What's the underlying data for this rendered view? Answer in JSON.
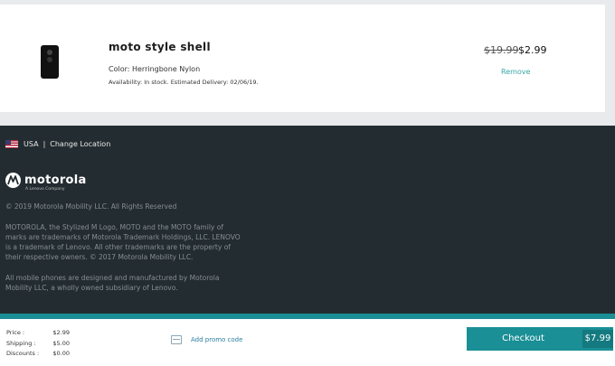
{
  "cart": {
    "item": {
      "name": "moto style shell",
      "color": "Color: Herringbone Nylon",
      "availability": "Availability: In stock. Estimated Delivery: 02/06/19.",
      "price_original": "$19.99",
      "price_current": "$2.99",
      "remove_label": "Remove",
      "image_icon": "phone-shell-icon"
    }
  },
  "footer": {
    "country": "USA",
    "separator": "|",
    "change_location": "Change Location",
    "logo_text": "motorola",
    "logo_sub": "A Lenovo Company",
    "copyright": "© 2019 Motorola Mobility LLC. All Rights Reserved",
    "legal_1": "MOTOROLA, the Stylized M Logo, MOTO and the MOTO family of marks are trademarks of Motorola Trademark Holdings, LLC. LENOVO is a trademark of Lenovo. All other trademarks are the property of their respective owners. © 2017 Motorola Mobility LLC.",
    "legal_2": "All mobile phones are designed and manufactured by Motorola Mobility LLC, a wholly owned subsidiary of Lenovo."
  },
  "summary": {
    "price_label": "Price :",
    "price_value": "$2.99",
    "shipping_label": "Shipping :",
    "shipping_value": "$5.00",
    "discounts_label": "Discounts :",
    "discounts_value": "$0.00",
    "promo_label": "Add promo code",
    "checkout_label": "Checkout",
    "checkout_total": "$7.99"
  },
  "colors": {
    "accent": "#1a8f96",
    "footer_bg": "#232d31",
    "link": "#3aa6a6"
  }
}
